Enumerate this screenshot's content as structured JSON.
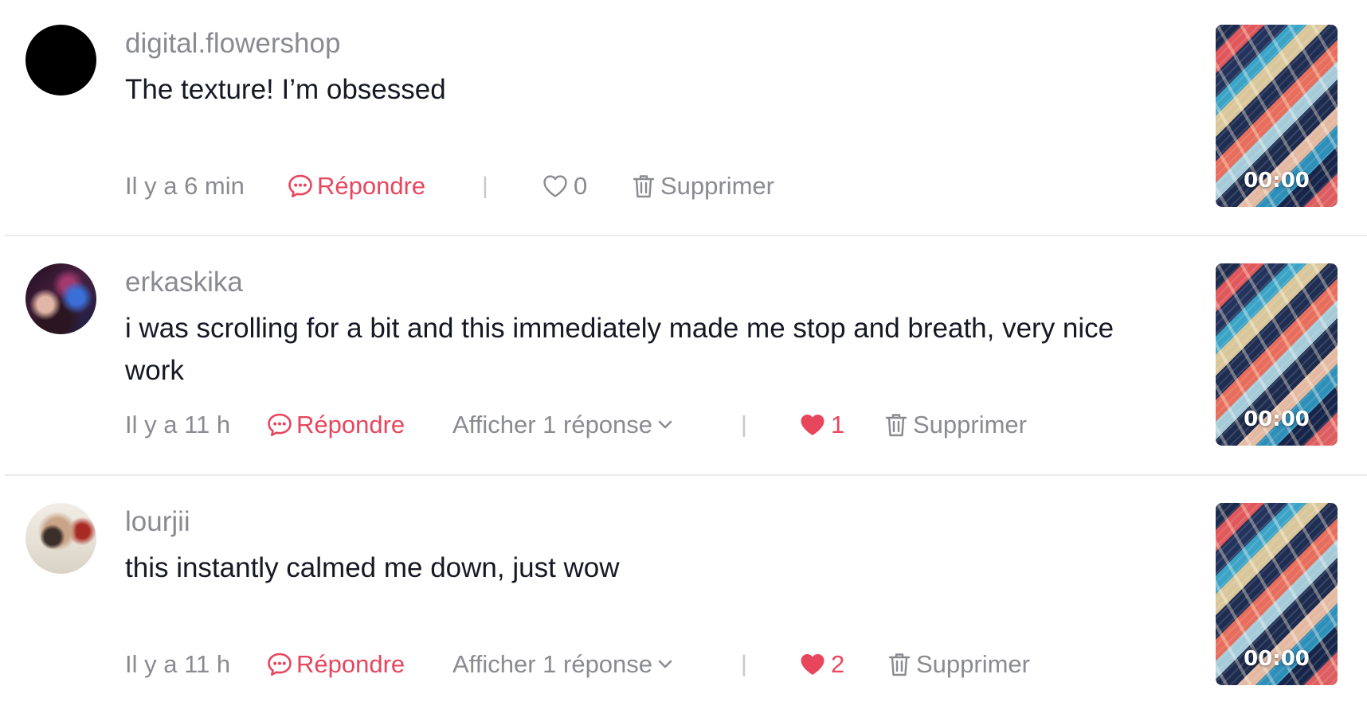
{
  "colors": {
    "accent": "#e8465d",
    "meta_text": "#8a8b91",
    "primary_text": "#161823",
    "divider": "#ececec"
  },
  "icons": {
    "reply": "speech-bubble-dots-icon",
    "like_empty": "heart-outline-icon",
    "like_filled": "heart-filled-icon",
    "delete": "trash-icon",
    "expand": "chevron-down-icon"
  },
  "comments": [
    {
      "username": "digital.flowershop",
      "text": "The texture! I’m obsessed",
      "time": "Il y a 6 min",
      "reply_label": "Répondre",
      "view_replies_label": "",
      "separator": "|",
      "like_count": "0",
      "liked": false,
      "delete_label": "Supprimer",
      "thumb_duration": "00:00"
    },
    {
      "username": "erkaskika",
      "text": "i was scrolling for a bit and this immediately made me stop and breath, very nice work",
      "time": "Il y a 11 h",
      "reply_label": "Répondre",
      "view_replies_label": "Afficher 1 réponse",
      "separator": "|",
      "like_count": "1",
      "liked": true,
      "delete_label": "Supprimer",
      "thumb_duration": "00:00"
    },
    {
      "username": "lourjii",
      "text": "this instantly calmed me down, just wow",
      "time": "Il y a 11 h",
      "reply_label": "Répondre",
      "view_replies_label": "Afficher 1 réponse",
      "separator": "|",
      "like_count": "2",
      "liked": true,
      "delete_label": "Supprimer",
      "thumb_duration": "00:00"
    }
  ]
}
